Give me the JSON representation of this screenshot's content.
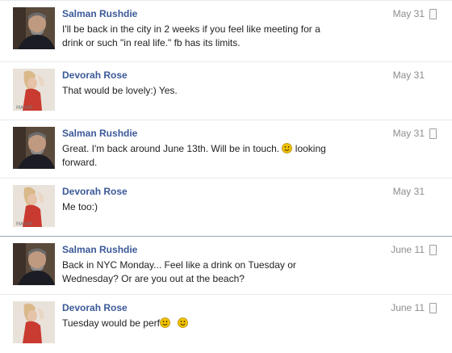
{
  "messages": [
    {
      "sender": "Salman Rushdie",
      "date": "May 31",
      "line1": "I'll be back in the city in 2 weeks if you feel like meeting for a",
      "line2": "drink or such \"in real life.\" fb has its limits."
    },
    {
      "sender": "Devorah Rose",
      "date": "May 31",
      "line1": "That would be lovely:) Yes."
    },
    {
      "sender": "Salman Rushdie",
      "date": "May 31",
      "line1a": "Great. I'm back around June 13th. Will be in touch.",
      "line1b": "looking",
      "line2": "forward."
    },
    {
      "sender": "Devorah Rose",
      "date": "May 31",
      "line1": "Me too:)"
    },
    {
      "sender": "Salman Rushdie",
      "date": "June 11",
      "line1": "Back in NYC Monday... Feel like a drink on Tuesday or",
      "line2": "Wednesday? Or are you out at the beach?"
    },
    {
      "sender": "Devorah Rose",
      "date": "June 11",
      "line1": "Tuesday would be perf"
    }
  ],
  "icons": {
    "delete": "trash-icon",
    "emoticon": "smiley-icon",
    "colors": {
      "name_link": "#3b5998",
      "smiley": "#f2c200"
    }
  }
}
